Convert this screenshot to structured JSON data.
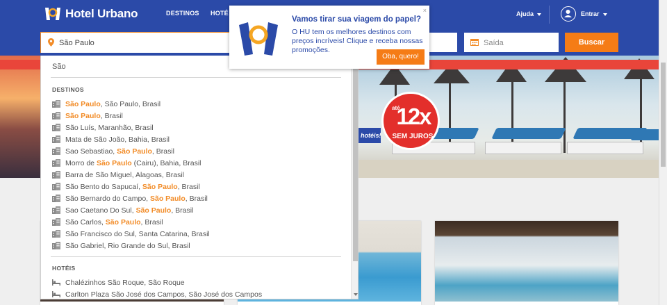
{
  "header": {
    "brand": "Hotel Urbano",
    "nav": [
      "DESTINOS",
      "HOTÉ"
    ],
    "help": "Ajuda",
    "login": "Entrar"
  },
  "search": {
    "destination_value": "São Paulo",
    "checkout_placeholder": "Saída",
    "button": "Buscar"
  },
  "dropdown": {
    "query": "São",
    "sections": {
      "destinations": "DESTINOS",
      "hotels": "HOTÉIS"
    },
    "destinations": [
      {
        "pre": "",
        "hl": "São Paulo",
        "post": ", São Paulo, Brasil"
      },
      {
        "pre": "",
        "hl": "São Paulo",
        "post": ", Brasil"
      },
      {
        "pre": "São Luís, Maranhão, Brasil",
        "hl": "",
        "post": ""
      },
      {
        "pre": "Mata de São João, Bahia, Brasil",
        "hl": "",
        "post": ""
      },
      {
        "pre": "Sao Sebastiao, ",
        "hl": "São Paulo",
        "post": ", Brasil"
      },
      {
        "pre": "Morro de ",
        "hl": "São Paulo",
        "post": " (Cairu), Bahia, Brasil"
      },
      {
        "pre": "Barra de São Miguel, Alagoas, Brasil",
        "hl": "",
        "post": ""
      },
      {
        "pre": "São Bento do Sapucaí, ",
        "hl": "São Paulo",
        "post": ", Brasil"
      },
      {
        "pre": "São Bernardo do Campo, ",
        "hl": "São Paulo",
        "post": ", Brasil"
      },
      {
        "pre": "Sao Caetano Do Sul, ",
        "hl": "São Paulo",
        "post": ", Brasil"
      },
      {
        "pre": "São Carlos, ",
        "hl": "São Paulo",
        "post": ", Brasil"
      },
      {
        "pre": "São Francisco do Sul, Santa Catarina, Brasil",
        "hl": "",
        "post": ""
      },
      {
        "pre": "São Gabriel, Rio Grande do Sul, Brasil",
        "hl": "",
        "post": ""
      }
    ],
    "hotels": [
      "Chalézinhos São Roque, São Roque",
      "Carlton Plaza São José dos Campos, São José dos Campos"
    ]
  },
  "hero": {
    "badge_prefix": "até",
    "badge_big": "12x",
    "badge_suffix": "SEM JUROS",
    "tag": "hotéis!"
  },
  "popup": {
    "close": "×",
    "title": "Vamos tirar sua viagem do papel?",
    "body": "O HU tem os melhores destinos com preços incríveis! Clique e receba nossas promoções.",
    "cta": "Oba, quero!"
  },
  "colors": {
    "brand_blue": "#2b4aa8",
    "accent_orange": "#f57c16",
    "highlight": "#f28c28",
    "stripe_red": "#e9453a"
  }
}
